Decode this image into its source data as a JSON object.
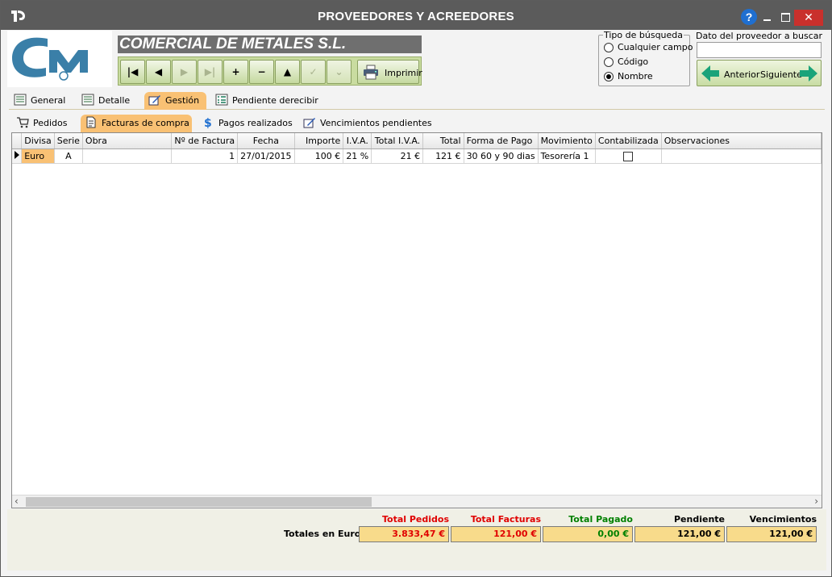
{
  "window": {
    "title": "PROVEEDORES Y ACREEDORES",
    "help_label": "?",
    "close_label": "✕"
  },
  "company": {
    "name": "COMERCIAL DE METALES S.L."
  },
  "toolbar": {
    "buttons": [
      {
        "name": "first-record",
        "glyph": "⏮",
        "enabled": true
      },
      {
        "name": "prev-record",
        "glyph": "◀",
        "enabled": true
      },
      {
        "name": "next-record",
        "glyph": "▶",
        "enabled": false
      },
      {
        "name": "last-record",
        "glyph": "⏭",
        "enabled": false
      },
      {
        "name": "add-record",
        "glyph": "+",
        "enabled": true
      },
      {
        "name": "delete-record",
        "glyph": "−",
        "enabled": true
      },
      {
        "name": "edit-record",
        "glyph": "▲",
        "enabled": true
      },
      {
        "name": "confirm-record",
        "glyph": "✓",
        "enabled": false
      },
      {
        "name": "cancel-record",
        "glyph": "⌄",
        "enabled": false
      }
    ],
    "print_label": "Imprimir"
  },
  "search": {
    "group_title": "Tipo de búsqueda",
    "options": [
      {
        "label": "Cualquier campo",
        "selected": false
      },
      {
        "label": "Código",
        "selected": false
      },
      {
        "label": "Nombre",
        "selected": true
      }
    ],
    "field_label": "Dato del proveedor a buscar",
    "value": "",
    "prev_label": "Anterior",
    "next_label": "Siguiente"
  },
  "main_tabs": [
    {
      "label": "General",
      "active": false,
      "icon": "list-icon"
    },
    {
      "label": "Detalle",
      "active": false,
      "icon": "list-icon"
    },
    {
      "label": "Gestión",
      "active": true,
      "icon": "edit-icon"
    },
    {
      "label": "Pendiente derecibir",
      "active": false,
      "icon": "checklist-icon"
    }
  ],
  "sub_tabs": [
    {
      "label": "Pedidos",
      "active": false,
      "icon": "cart-icon"
    },
    {
      "label": "Facturas de compra",
      "active": true,
      "icon": "document-icon"
    },
    {
      "label": "Pagos realizados",
      "active": false,
      "icon": "dollar-icon"
    },
    {
      "label": "Vencimientos pendientes",
      "active": false,
      "icon": "edit-icon"
    }
  ],
  "grid": {
    "columns": [
      "Divisa",
      "Serie",
      "Obra",
      "Nº de Factura",
      "Fecha",
      "Importe",
      "I.V.A.",
      "Total I.V.A.",
      "Total",
      "Forma de Pago",
      "Movimiento",
      "Contabilizada",
      "Observaciones"
    ],
    "rows": [
      {
        "divisa": "Euro",
        "serie": "A",
        "obra": "",
        "factura": "1",
        "fecha": "27/01/2015",
        "importe": "100 €",
        "iva": "21 %",
        "total_iva": "21 €",
        "total": "121 €",
        "forma_pago": "30  60 y 90 dias",
        "movimiento": "Tesorería 1",
        "contabilizada": false,
        "observaciones": ""
      }
    ]
  },
  "totals": {
    "row_label": "Totales en Euro",
    "items": [
      {
        "label": "Total Pedidos",
        "value": "3.833,47 €",
        "color": "#e00000"
      },
      {
        "label": "Total Facturas",
        "value": "121,00 €",
        "color": "#e00000"
      },
      {
        "label": "Total Pagado",
        "value": "0,00 €",
        "color": "#008000"
      },
      {
        "label": "Pendiente",
        "value": "121,00 €",
        "color": "#000000"
      },
      {
        "label": "Vencimientos",
        "value": "121,00 €",
        "color": "#000000"
      }
    ]
  },
  "colors": {
    "titlebar": "#5b5b5b",
    "active_tab": "#f9c174",
    "toolbar_green": "#c9dca0",
    "totals_fill": "#f8db8b",
    "arrow_green": "#1aa37a"
  }
}
